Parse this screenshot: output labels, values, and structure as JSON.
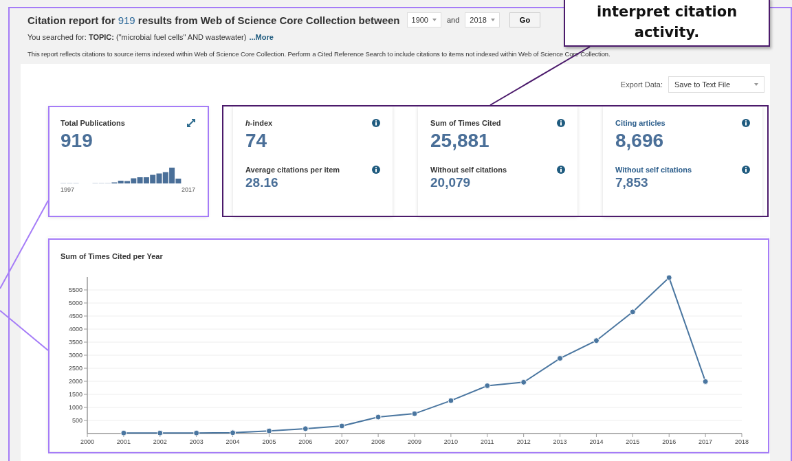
{
  "header": {
    "title_before": "Citation report for",
    "count": "919",
    "title_after": "results from Web of Science Core Collection  between",
    "year_from": "1900",
    "and_label": "and",
    "year_to": "2018",
    "go_button": "Go",
    "search_summary": "You searched for: **TOPIC:** (\"microbial fuel cells\" AND wastewater)",
    "more_link": "...More",
    "note": "This report reflects citations to source items indexed within Web of Science Core Collection. Perform a Cited Reference Search to include citations to items not indexed within Web of Science Core Collection."
  },
  "export": {
    "label": "Export Data:",
    "value": "Save to Text File"
  },
  "publications_card": {
    "title": "Total Publications",
    "value": "919",
    "start_year": "1997",
    "end_year": "2017"
  },
  "metric_cards": [
    {
      "kind": "plain",
      "title": "*h*-index",
      "value": "74",
      "sub_title": "Average citations per item",
      "sub_value": "28.16"
    },
    {
      "kind": "plain",
      "title": "Sum of Times Cited",
      "value": "25,881",
      "sub_title": "Without self citations",
      "sub_value": "20,079"
    },
    {
      "kind": "link",
      "title": "Citing articles",
      "value": "8,696",
      "sub_title": "Without self citations",
      "sub_value": "7,853"
    }
  ],
  "times_cited_chart": {
    "title": "Sum of Times Cited per Year",
    "chart_data": {
      "type": "line",
      "x": [
        2001,
        2002,
        2003,
        2004,
        2005,
        2006,
        2007,
        2008,
        2009,
        2010,
        2011,
        2012,
        2013,
        2014,
        2015,
        2016,
        2017
      ],
      "grid": true,
      "series": [
        {
          "color": "#4a76a0",
          "marker": "circle",
          "values": [
            20,
            20,
            20,
            30,
            100,
            185,
            290,
            630,
            760,
            1260,
            1830,
            1965,
            2880,
            3560,
            4660,
            5970,
            1990
          ]
        }
      ],
      "xlim": [
        2000,
        2018
      ],
      "ylim": [
        0,
        6000
      ],
      "xticks": [
        2000,
        2001,
        2002,
        2003,
        2004,
        2005,
        2006,
        2007,
        2008,
        2009,
        2010,
        2011,
        2012,
        2013,
        2014,
        2015,
        2016,
        2017,
        2018
      ],
      "yticks": [
        500,
        1000,
        1500,
        2000,
        2500,
        3000,
        3500,
        4000,
        4500,
        5000,
        5500
      ]
    }
  },
  "callout": {
    "lines": [
      "interpret citation",
      "activity."
    ]
  }
}
